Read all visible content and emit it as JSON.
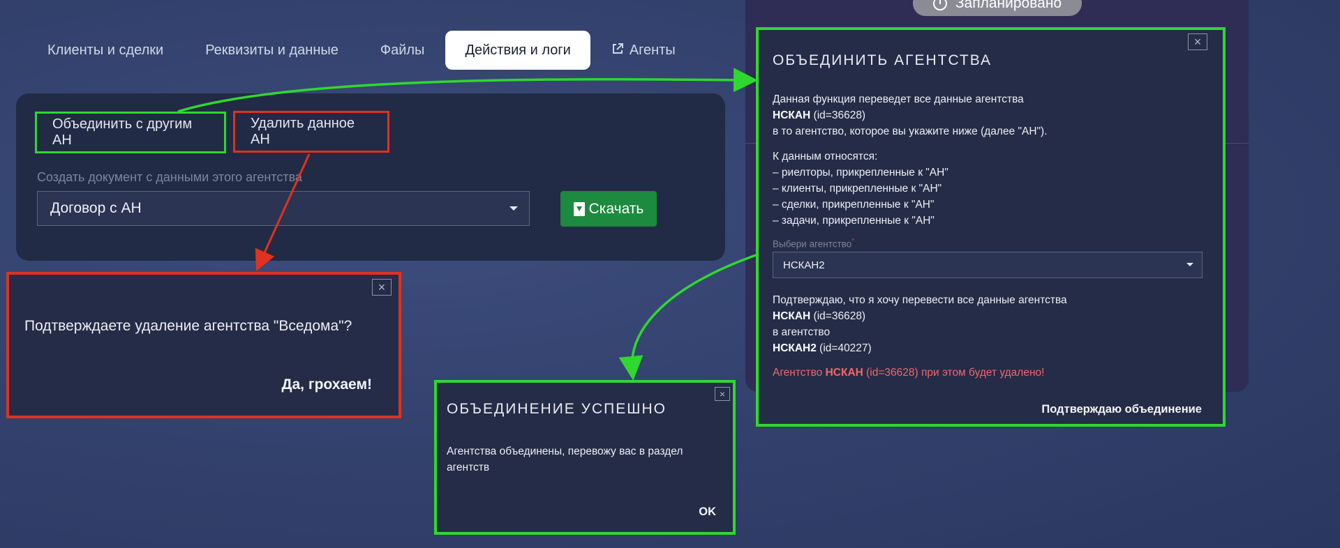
{
  "tabs": [
    {
      "label": "Клиенты и сделки"
    },
    {
      "label": "Реквизиты и данные"
    },
    {
      "label": "Файлы"
    },
    {
      "label": "Действия и логи"
    },
    {
      "label": "Агенты"
    }
  ],
  "status_pill": "Запланировано",
  "card": {
    "merge_button": "Объединить с другим АН",
    "delete_button": "Удалить данное АН",
    "doc_label": "Создать документ с данными этого агентства",
    "doc_select_value": "Договор с АН",
    "download_button": "Скачать"
  },
  "merge_dialog": {
    "title": "ОБЪЕДИНИТЬ АГЕНТСТВА",
    "intro_line1": "Данная функция переведет все данные агентства",
    "agency_name": "НСКАН",
    "agency_id": " (id=36628)",
    "intro_line3": "в то агентство, которое вы укажите ниже (далее \"АН\").",
    "data_header": "К данным относятся:",
    "data_items": [
      "– риелторы, прикрепленные к \"АН\"",
      "– клиенты, прикрепленные к \"АН\"",
      "– сделки, прикрепленные к \"АН\"",
      "– задачи, прикрепленные к \"АН\""
    ],
    "select_label": "Выбери агентство",
    "select_required": "*",
    "select_value": "НСКАН2",
    "confirm_line1": "Подтверждаю, что я хочу перевести все данные агентства",
    "confirm_agency": "НСКАН",
    "confirm_agency_id": " (id=36628)",
    "confirm_line3": "в агентство",
    "target_agency": "НСКАН2",
    "target_agency_id": " (id=40227)",
    "warn_prefix": "Агентство ",
    "warn_agency": "НСКАН",
    "warn_suffix": " (id=36628) при этом будет удалено!",
    "confirm_button": "Подтверждаю объединение",
    "close": "×"
  },
  "delete_dialog": {
    "question": "Подтверждаете удаление агентства \"Вседома\"?",
    "yes_button": "Да, грохаем!",
    "close": "×"
  },
  "success_dialog": {
    "title": "ОБЪЕДИНЕНИЕ УСПЕШНО",
    "message": "Агентства объединены, перевожу вас в раздел агентств",
    "ok_button": "OK",
    "close": "×"
  },
  "colors": {
    "annotation_green": "#2fd82f",
    "annotation_red": "#e0321f",
    "download_green": "#1c8a3f",
    "warning_red": "#f1686b"
  },
  "icons": [
    "clock-icon",
    "external-link-icon",
    "download-file-icon",
    "close-icon",
    "caret-down-icon"
  ]
}
